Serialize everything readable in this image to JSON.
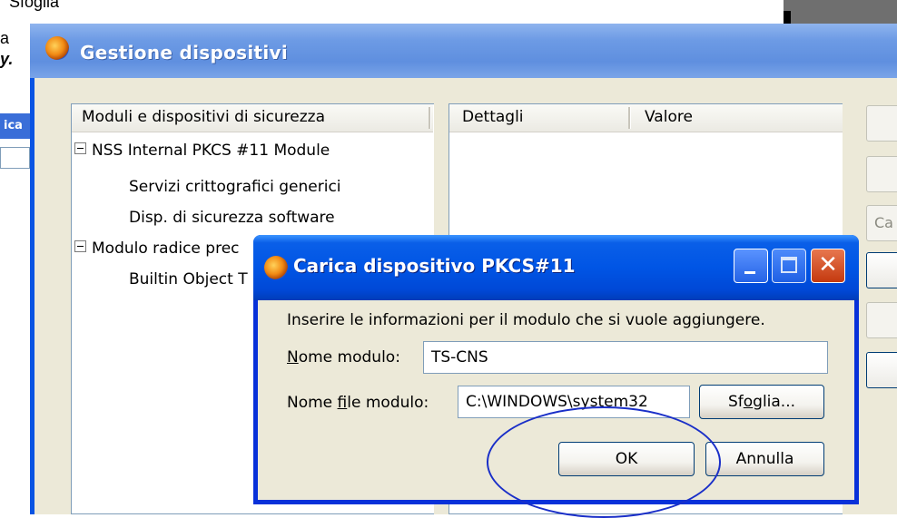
{
  "background": {
    "top_text": "Sfoglia",
    "side_text_1": "a",
    "side_text_2": "y.",
    "side_label": "ica"
  },
  "main_window": {
    "title": "Gestione dispositivi",
    "tree": {
      "header": "Moduli e dispositivi di sicurezza",
      "rows": [
        {
          "label": "NSS Internal PKCS #11 Module",
          "expandable": true
        },
        {
          "label": "Servizi crittografici generici",
          "expandable": false
        },
        {
          "label": "Disp. di sicurezza software",
          "expandable": false
        },
        {
          "label": "Modulo radice prec",
          "expandable": true
        },
        {
          "label": "Builtin Object T",
          "expandable": false
        }
      ]
    },
    "details": {
      "col_details": "Dettagli",
      "col_value": "Valore"
    },
    "side_buttons": [
      "",
      "",
      "Ca",
      "",
      "",
      ""
    ]
  },
  "dialog": {
    "title": "Carica dispositivo PKCS#11",
    "instruction": "Inserire le informazioni per il modulo che si vuole aggiungere.",
    "module_name_label": "Nome modulo:",
    "module_name_value": "TS-CNS",
    "module_file_label": "Nome file modulo:",
    "module_file_value": "C:\\WINDOWS\\system32",
    "browse_label": "Sfoglia...",
    "ok_label": "OK",
    "cancel_label": "Annulla"
  },
  "colors": {
    "dialog_title_blue": "#0055e5",
    "window_face": "#ece9d8",
    "highlight_ellipse": "#1a2fc8"
  }
}
